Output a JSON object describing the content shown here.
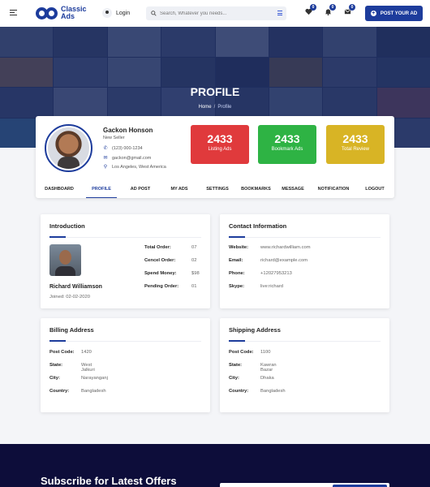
{
  "header": {
    "logo_line1": "Classic",
    "logo_line2": "Ads",
    "login_label": "Login",
    "search_placeholder": "Search, Whatever you needs...",
    "favorites_count": "0",
    "notifications_count": "0",
    "messages_count": "0",
    "post_ad_label": "POST YOUR AD"
  },
  "hero": {
    "title": "PROFILE",
    "breadcrumb_home": "Home",
    "breadcrumb_sep": "/",
    "breadcrumb_current": "Profile"
  },
  "profile": {
    "name": "Gackon Honson",
    "role": "New Seller",
    "phone": "(123) 000-1234",
    "email": "gackon@gmail.com",
    "location": "Los Angeles, West America",
    "stats": [
      {
        "value": "2433",
        "label": "Listing Ads",
        "color": "#e03a3c"
      },
      {
        "value": "2433",
        "label": "Bookmark Ads",
        "color": "#2eb344"
      },
      {
        "value": "2433",
        "label": "Total Review",
        "color": "#d8b425"
      }
    ],
    "tabs": [
      "DASHBOARD",
      "PROFILE",
      "AD POST",
      "MY ADS",
      "SETTINGS",
      "BOOKMARKS",
      "MESSAGE",
      "NOTIFICATION",
      "LOGOUT"
    ],
    "active_tab": "PROFILE"
  },
  "introduction": {
    "title": "Introduction",
    "name": "Richard Williamson",
    "joined": "Joined: 02-02-2020",
    "rows": [
      {
        "label": "Total Order:",
        "value": "07"
      },
      {
        "label": "Cencel Order:",
        "value": "02"
      },
      {
        "label": "Spend Money:",
        "value": "$98"
      },
      {
        "label": "Pending Order:",
        "value": "01"
      }
    ]
  },
  "contact": {
    "title": "Contact Information",
    "rows": [
      {
        "label": "Website:",
        "value": "www.richardwilliam.com"
      },
      {
        "label": "Email:",
        "value": "richard@example.com"
      },
      {
        "label": "Phone:",
        "value": "+12027953213"
      },
      {
        "label": "Skype:",
        "value": "live:richard"
      }
    ]
  },
  "billing": {
    "title": "Billing Address",
    "rows": [
      {
        "label": "Post Code:",
        "value": "1420"
      },
      {
        "label": "State:",
        "value": "West Jalkuri"
      },
      {
        "label": "City:",
        "value": "Narayanganj"
      },
      {
        "label": "Country:",
        "value": "Bangladesh"
      }
    ]
  },
  "shipping": {
    "title": "Shipping Address",
    "rows": [
      {
        "label": "Post Code:",
        "value": "1100"
      },
      {
        "label": "State:",
        "value": "Kawran Bazar"
      },
      {
        "label": "City:",
        "value": "Dhaka"
      },
      {
        "label": "Country:",
        "value": "Bangladesh"
      }
    ]
  },
  "footer": {
    "subscribe_title": "Subscribe for Latest Offers"
  },
  "colors": {
    "brand": "#1d3c9c",
    "footer_bg": "#0d0d3a"
  }
}
